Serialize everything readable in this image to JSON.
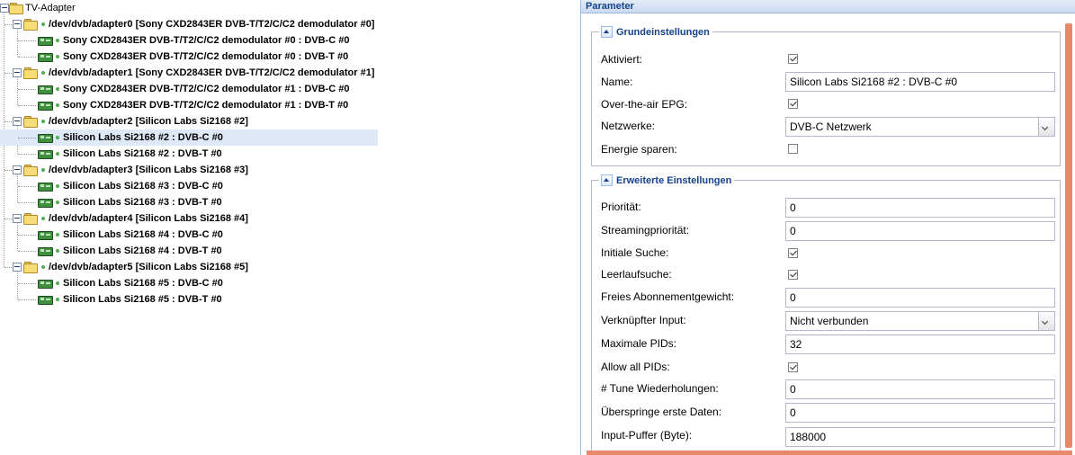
{
  "tree": {
    "root": "TV-Adapter",
    "adapters": [
      {
        "label": "/dev/dvb/adapter0 [Sony CXD2843ER DVB-T/T2/C/C2 demodulator #0]",
        "children": [
          "Sony CXD2843ER DVB-T/T2/C/C2 demodulator #0 : DVB-C #0",
          "Sony CXD2843ER DVB-T/T2/C/C2 demodulator #0 : DVB-T #0"
        ]
      },
      {
        "label": "/dev/dvb/adapter1 [Sony CXD2843ER DVB-T/T2/C/C2 demodulator #1]",
        "children": [
          "Sony CXD2843ER DVB-T/T2/C/C2 demodulator #1 : DVB-C #0",
          "Sony CXD2843ER DVB-T/T2/C/C2 demodulator #1 : DVB-T #0"
        ]
      },
      {
        "label": "/dev/dvb/adapter2 [Silicon Labs Si2168 #2]",
        "children": [
          "Silicon Labs Si2168 #2 : DVB-C #0",
          "Silicon Labs Si2168 #2 : DVB-T #0"
        ]
      },
      {
        "label": "/dev/dvb/adapter3 [Silicon Labs Si2168 #3]",
        "children": [
          "Silicon Labs Si2168 #3 : DVB-C #0",
          "Silicon Labs Si2168 #3 : DVB-T #0"
        ]
      },
      {
        "label": "/dev/dvb/adapter4 [Silicon Labs Si2168 #4]",
        "children": [
          "Silicon Labs Si2168 #4 : DVB-C #0",
          "Silicon Labs Si2168 #4 : DVB-T #0"
        ]
      },
      {
        "label": "/dev/dvb/adapter5 [Silicon Labs Si2168 #5]",
        "children": [
          "Silicon Labs Si2168 #5 : DVB-C #0",
          "Silicon Labs Si2168 #5 : DVB-T #0"
        ]
      }
    ]
  },
  "panel": {
    "title": "Parameter",
    "basic": {
      "legend": "Grundeinstellungen",
      "enabled_label": "Aktiviert:",
      "enabled": true,
      "name_label": "Name:",
      "name_value": "Silicon Labs Si2168 #2 : DVB-C #0",
      "epg_label": "Over-the-air EPG:",
      "epg": true,
      "networks_label": "Netzwerke:",
      "networks_value": "DVB-C Netzwerk",
      "power_label": "Energie sparen:",
      "power": false
    },
    "advanced": {
      "legend": "Erweiterte Einstellungen",
      "priority_label": "Priorität:",
      "priority_value": "0",
      "streaming_priority_label": "Streamingpriorität:",
      "streaming_priority_value": "0",
      "initial_scan_label": "Initiale Suche:",
      "initial_scan": true,
      "idle_scan_label": "Leerlaufsuche:",
      "idle_scan": true,
      "free_sub_weight_label": "Freies Abonnementgewicht:",
      "free_sub_weight_value": "0",
      "linked_input_label": "Verknüpfter Input:",
      "linked_input_value": "Nicht verbunden",
      "max_pids_label": "Maximale PIDs:",
      "max_pids_value": "32",
      "allow_all_pids_label": "Allow all PIDs:",
      "allow_all_pids": true,
      "tune_repeats_label": "# Tune Wiederholungen:",
      "tune_repeats_value": "0",
      "skip_initial_label": "Überspringe erste Daten:",
      "skip_initial_value": "0",
      "input_buffer_label": "Input-Puffer (Byte):",
      "input_buffer_value": "188000"
    }
  },
  "colors": {
    "selection": "#dfe8f6",
    "header_text": "#15428b",
    "scrollbar": "#e7896a"
  },
  "selected": {
    "adapter": 2,
    "child": 0
  }
}
